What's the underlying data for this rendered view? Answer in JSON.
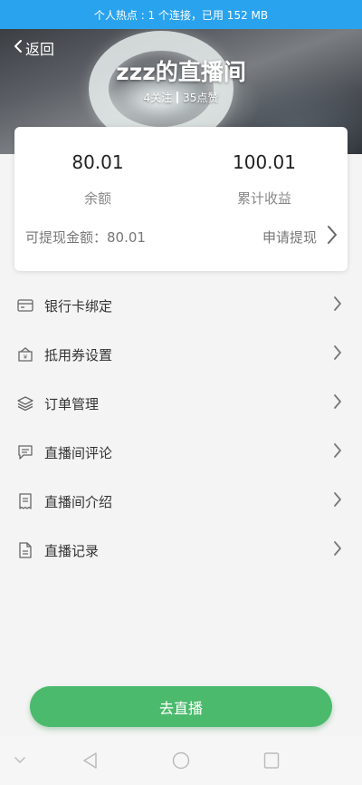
{
  "status_bar": {
    "text": "个人热点 : 1 个连接，已用 152 MB"
  },
  "header": {
    "back_label": "返回",
    "title": "zzz的直播间",
    "follow_text": "4关注",
    "like_text": "35点赞"
  },
  "balance": {
    "balance_value": "80.01",
    "balance_label": "余额",
    "earnings_value": "100.01",
    "earnings_label": "累计收益",
    "withdrawable_text": "可提现金额：80.01",
    "apply_label": "申请提现"
  },
  "menu": {
    "items": [
      {
        "label": "银行卡绑定",
        "icon": "bank-card-icon"
      },
      {
        "label": "抵用券设置",
        "icon": "coupon-icon"
      },
      {
        "label": "订单管理",
        "icon": "layers-icon"
      },
      {
        "label": "直播间评论",
        "icon": "comment-icon"
      },
      {
        "label": "直播间介绍",
        "icon": "receipt-icon"
      },
      {
        "label": "直播记录",
        "icon": "document-icon"
      }
    ]
  },
  "go_live_label": "去直播",
  "colors": {
    "status_bar": "#2aa3ef",
    "primary_button": "#4cba6d"
  }
}
